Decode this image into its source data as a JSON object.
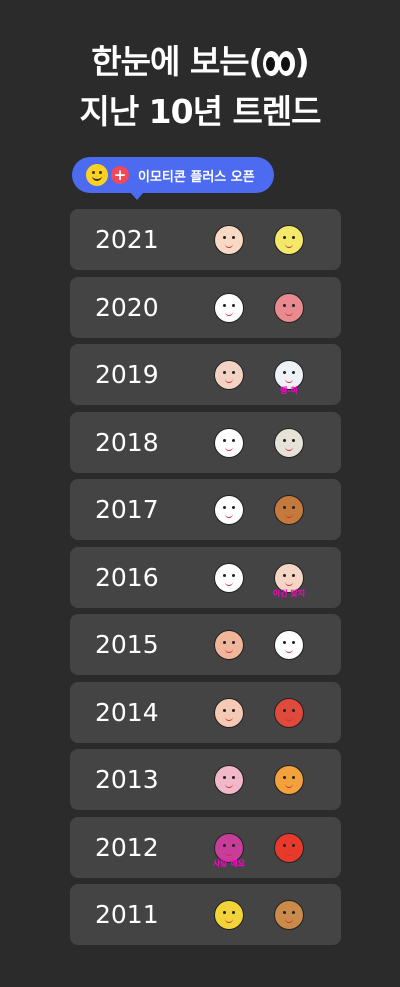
{
  "headline": {
    "line1": "한눈에 보는(",
    "line1_end": ")",
    "line2": "지난 10년 트렌드"
  },
  "badge": {
    "icons": [
      "smiley-face-icon",
      "plus-icon"
    ],
    "plus_glyph": "+",
    "label": "이모티콘 플러스 오픈"
  },
  "years": [
    {
      "year": "2021",
      "emoticons": [
        {
          "color": "#f7d9c4"
        },
        {
          "color": "#f3e86a"
        }
      ]
    },
    {
      "year": "2020",
      "emoticons": [
        {
          "color": "#ffffff"
        },
        {
          "color": "#e88a8f"
        }
      ]
    },
    {
      "year": "2019",
      "emoticons": [
        {
          "color": "#f2d2c4"
        },
        {
          "color": "#eef2f6",
          "caption": "펭-하"
        }
      ]
    },
    {
      "year": "2018",
      "emoticons": [
        {
          "color": "#ffffff"
        },
        {
          "color": "#e6e2d8"
        }
      ]
    },
    {
      "year": "2017",
      "emoticons": [
        {
          "color": "#ffffff"
        },
        {
          "color": "#c47a3c"
        }
      ]
    },
    {
      "year": "2016",
      "emoticons": [
        {
          "color": "#ffffff"
        },
        {
          "color": "#f5d6c4",
          "caption": "이건 맞지"
        }
      ]
    },
    {
      "year": "2015",
      "emoticons": [
        {
          "color": "#f0b59a"
        },
        {
          "color": "#ffffff"
        }
      ]
    },
    {
      "year": "2014",
      "emoticons": [
        {
          "color": "#f6c9b5"
        },
        {
          "color": "#e04a3c"
        }
      ]
    },
    {
      "year": "2013",
      "emoticons": [
        {
          "color": "#f0b8c8"
        },
        {
          "color": "#f3a13a"
        }
      ]
    },
    {
      "year": "2012",
      "emoticons": [
        {
          "color": "#c83c9a",
          "caption": "사랑 해요"
        },
        {
          "color": "#e83a2a"
        }
      ]
    },
    {
      "year": "2011",
      "emoticons": [
        {
          "color": "#f2d33a"
        },
        {
          "color": "#c98a4a"
        }
      ]
    }
  ]
}
